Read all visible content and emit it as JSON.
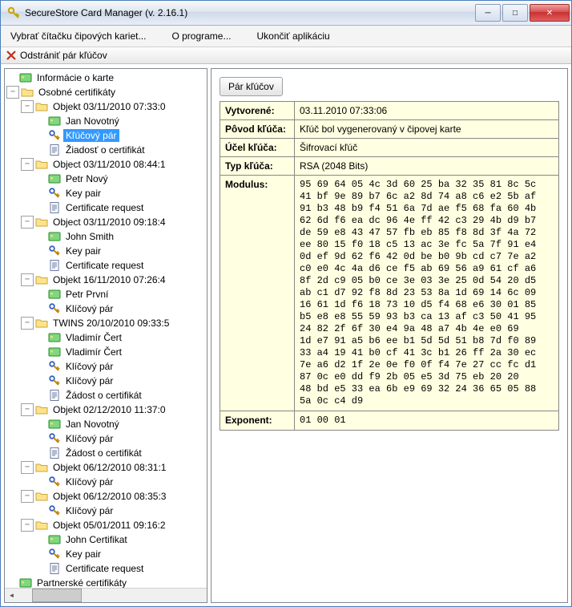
{
  "window": {
    "title": "SecureStore Card Manager (v. 2.16.1)"
  },
  "menu": {
    "readers": "Vybrať čítačku čipových kariet...",
    "about": "O programe...",
    "quit": "Ukončiť aplikáciu"
  },
  "toolbar": {
    "delete_pair": "Odstrániť pár kľúčov"
  },
  "tree": {
    "card_info": "Informácie o karte",
    "personal": "Osobné certifikáty",
    "partner": "Partnerské certifikáty",
    "items": [
      {
        "label": "Objekt 03/11/2010 07:33:0",
        "children": [
          {
            "icon": "card",
            "label": "Jan Novotný"
          },
          {
            "icon": "key",
            "label": "Kľúčový pár",
            "selected": true
          },
          {
            "icon": "req",
            "label": "Žiadosť o certifikát"
          }
        ]
      },
      {
        "label": "Object 03/11/2010 08:44:1",
        "children": [
          {
            "icon": "card",
            "label": "Petr Nový"
          },
          {
            "icon": "key",
            "label": "Key pair"
          },
          {
            "icon": "req",
            "label": "Certificate request"
          }
        ]
      },
      {
        "label": "Object 03/11/2010 09:18:4",
        "children": [
          {
            "icon": "card",
            "label": "John Smith"
          },
          {
            "icon": "key",
            "label": "Key pair"
          },
          {
            "icon": "req",
            "label": "Certificate request"
          }
        ]
      },
      {
        "label": "Objekt 16/11/2010 07:26:4",
        "children": [
          {
            "icon": "card",
            "label": "Petr První"
          },
          {
            "icon": "key",
            "label": "Klíčový pár"
          }
        ]
      },
      {
        "label": "TWINS 20/10/2010 09:33:5",
        "children": [
          {
            "icon": "card",
            "label": "Vladimír Čert"
          },
          {
            "icon": "card",
            "label": "Vladimír Čert"
          },
          {
            "icon": "key",
            "label": "Klíčový pár"
          },
          {
            "icon": "key",
            "label": "Klíčový pár"
          },
          {
            "icon": "req",
            "label": "Žádost o certifikát"
          }
        ]
      },
      {
        "label": "Objekt 02/12/2010 11:37:0",
        "children": [
          {
            "icon": "card",
            "label": "Jan Novotný"
          },
          {
            "icon": "key",
            "label": "Klíčový pár"
          },
          {
            "icon": "req",
            "label": "Žádost o certifikát"
          }
        ]
      },
      {
        "label": "Objekt 06/12/2010 08:31:1",
        "children": [
          {
            "icon": "key",
            "label": "Klíčový pár"
          }
        ]
      },
      {
        "label": "Objekt 06/12/2010 08:35:3",
        "children": [
          {
            "icon": "key",
            "label": "Klíčový pár"
          }
        ]
      },
      {
        "label": "Objekt 05/01/2011 09:16:2",
        "children": [
          {
            "icon": "card",
            "label": "John Certifikat"
          },
          {
            "icon": "key",
            "label": "Key pair"
          },
          {
            "icon": "req",
            "label": "Certificate request"
          }
        ]
      }
    ]
  },
  "details": {
    "button": "Pár kľúčov",
    "rows": {
      "created_k": "Vytvorené:",
      "created_v": "03.11.2010 07:33:06",
      "origin_k": "Pôvod kľúča:",
      "origin_v": "Kľúč bol vygenerovaný v čipovej karte",
      "purpose_k": "Účel kľúča:",
      "purpose_v": "Šifrovací kľúč",
      "type_k": "Typ kľúča:",
      "type_v": "RSA (2048 Bits)",
      "modulus_k": "Modulus:",
      "modulus_v": "95 69 64 05 4c 3d 60 25 ba 32 35 81 8c 5c\n41 bf 9e 89 b7 6c a2 8d 74 a8 c6 e2 5b af\n91 b3 48 b9 f4 51 6a 7d ae f5 68 fa 60 4b\n62 6d f6 ea dc 96 4e ff 42 c3 29 4b d9 b7\nde 59 e8 43 47 57 fb eb 85 f8 8d 3f 4a 72\nee 80 15 f0 18 c5 13 ac 3e fc 5a 7f 91 e4\n0d ef 9d 62 f6 42 0d be b0 9b cd c7 7e a2\nc0 e0 4c 4a d6 ce f5 ab 69 56 a9 61 cf a6\n8f 2d c9 05 b0 ce 3e 03 3e 25 0d 54 20 d5\nab c1 d7 92 f8 8d 23 53 8a 1d 69 14 6c 09\n16 61 1d f6 18 73 10 d5 f4 68 e6 30 01 85\nb5 e8 e8 55 59 93 b3 ca 13 af c3 50 41 95\n24 82 2f 6f 30 e4 9a 48 a7 4b 4e e0 69\n1d e7 91 a5 b6 ee b1 5d 5d 51 b8 7d f0 89\n33 a4 19 41 b0 cf 41 3c b1 26 ff 2a 30 ec\n7e a6 d2 1f 2e 0e f0 0f f4 7e 27 cc fc d1\n87 0c e0 dd f9 2b 05 e5 3d 75 eb 20 20\n48 bd e5 33 ea 6b e9 69 32 24 36 65 05 88\n5a 0c c4 d9",
      "exponent_k": "Exponent:",
      "exponent_v": "01 00 01"
    }
  }
}
